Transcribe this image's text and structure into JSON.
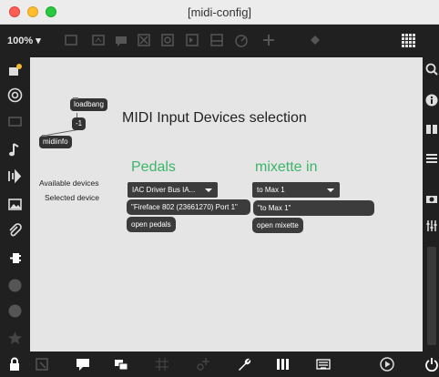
{
  "window": {
    "title": "[midi-config]"
  },
  "toolbar": {
    "zoom": "100%"
  },
  "patch": {
    "title": "MIDI Input Devices selection",
    "objects": {
      "loadbang": "loadbang",
      "minus_one": "-1",
      "midiinfo": "midiinfo"
    },
    "labels": {
      "available": "Available devices",
      "selected": "Selected device"
    },
    "pedals": {
      "heading": "Pedals",
      "menu_value": "IAC Driver Bus IA...",
      "selected_message": "\"Fireface 802 (23661270) Port 1\"",
      "open_message": "open pedals"
    },
    "mixette": {
      "heading": "mixette in",
      "menu_value": "to Max 1",
      "selected_message": "\"to Max 1\"",
      "open_message": "open mixette"
    }
  },
  "colors": {
    "heading_green": "#3cb56a",
    "canvas": "#e5e5e5",
    "chrome": "#202020"
  }
}
